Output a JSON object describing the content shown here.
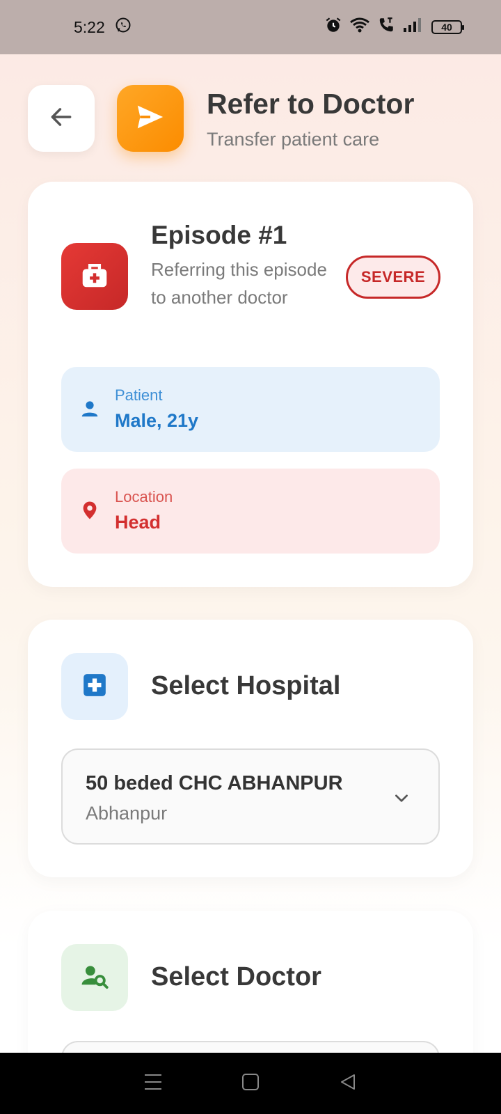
{
  "status_bar": {
    "time": "5:22",
    "battery": "40",
    "icons": [
      "whatsapp-icon",
      "alarm-icon",
      "wifi-icon",
      "call-icon",
      "signal-icon",
      "battery-icon"
    ]
  },
  "header": {
    "title": "Refer to Doctor",
    "subtitle": "Transfer patient care",
    "icon": "send-icon",
    "accent": "#fb8c00"
  },
  "episode": {
    "title": "Episode #1",
    "description": "Referring this episode to another doctor",
    "severity": "SEVERE",
    "severity_color": "#c62828",
    "patient": {
      "label": "Patient",
      "value": "Male, 21y"
    },
    "location": {
      "label": "Location",
      "value": "Head"
    }
  },
  "hospital": {
    "section_title": "Select Hospital",
    "selected_name": "50 beded CHC ABHANPUR",
    "selected_sub": "Abhanpur"
  },
  "doctor": {
    "section_title": "Select Doctor"
  },
  "nav": [
    "menu-icon",
    "home-icon",
    "back-icon"
  ]
}
